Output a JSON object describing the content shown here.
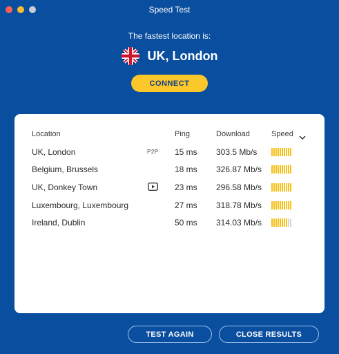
{
  "window": {
    "title": "Speed Test"
  },
  "hero": {
    "label": "The fastest location is:",
    "location": "UK, London",
    "flag_icon": "uk-flag-icon",
    "connect_label": "CONNECT",
    "accent": "#fcc72a"
  },
  "table": {
    "headers": {
      "location": "Location",
      "ping": "Ping",
      "download": "Download",
      "speed": "Speed"
    },
    "rows": [
      {
        "location": "UK, London",
        "badge": "P2P",
        "ping": "15 ms",
        "download": "303.5 Mb/s",
        "speed_level": 1.0
      },
      {
        "location": "Belgium, Brussels",
        "badge": "",
        "ping": "18 ms",
        "download": "326.87 Mb/s",
        "speed_level": 1.0
      },
      {
        "location": "UK, Donkey Town",
        "badge": "play-icon",
        "ping": "23 ms",
        "download": "296.58 Mb/s",
        "speed_level": 1.0
      },
      {
        "location": "Luxembourg, Luxembourg",
        "badge": "",
        "ping": "27 ms",
        "download": "318.78 Mb/s",
        "speed_level": 1.0
      },
      {
        "location": "Ireland, Dublin",
        "badge": "",
        "ping": "50 ms",
        "download": "314.03 Mb/s",
        "speed_level": 0.8
      }
    ]
  },
  "footer": {
    "test_again_label": "TEST AGAIN",
    "close_results_label": "CLOSE RESULTS"
  },
  "colors": {
    "background": "#0a4f9f",
    "bar_on": "#f5c21b",
    "bar_off": "#d6d6d6"
  }
}
